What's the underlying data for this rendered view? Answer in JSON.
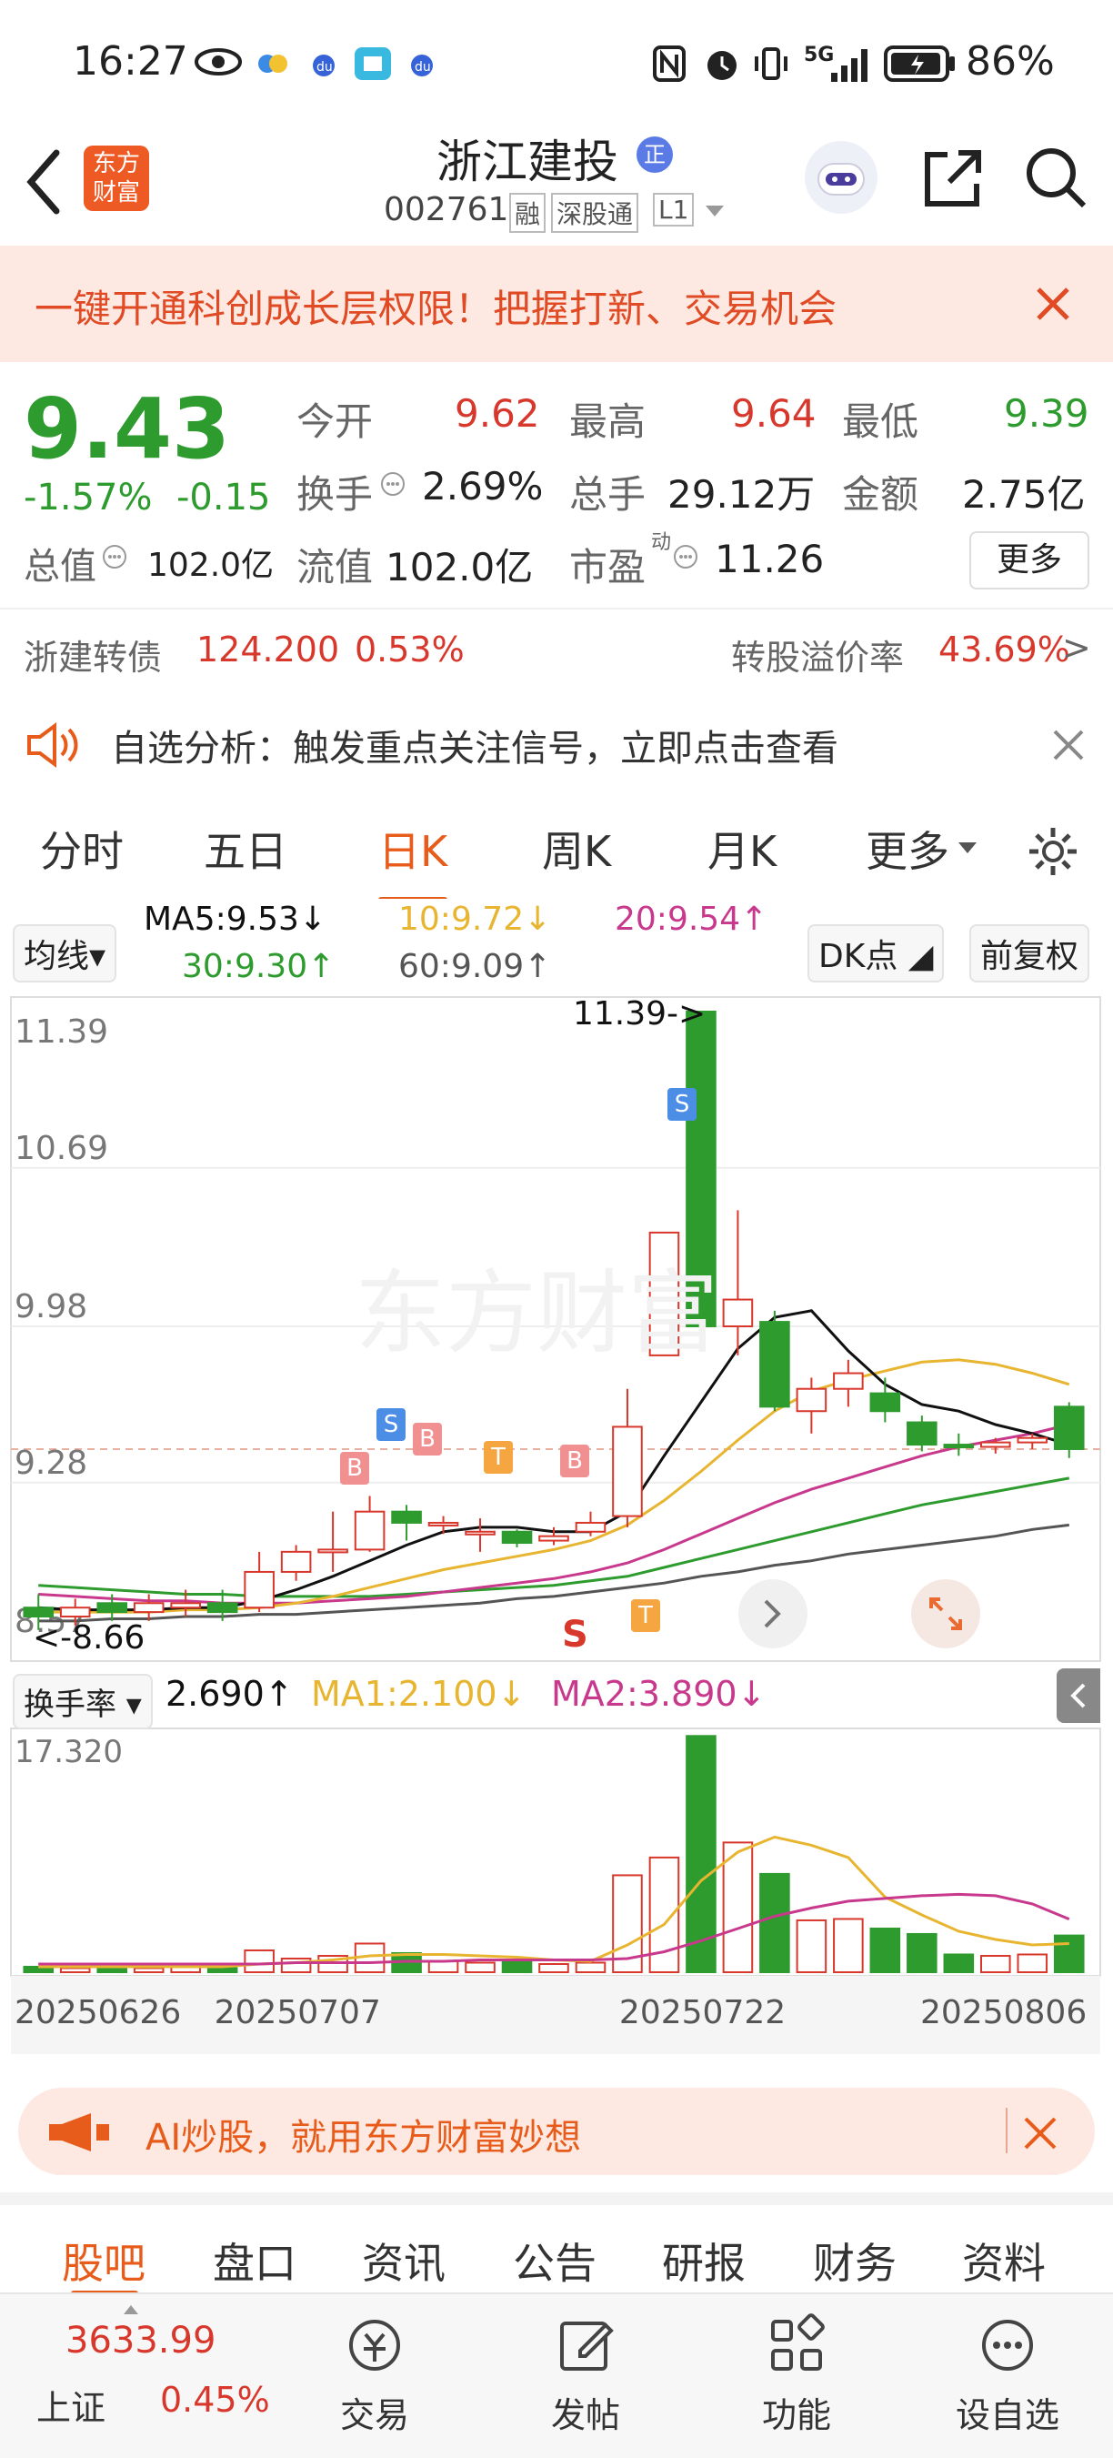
{
  "status_bar": {
    "time": "16:27",
    "network": "5G",
    "battery": "86%"
  },
  "header": {
    "back_label": "<",
    "logo_line1": "东方",
    "logo_line2": "财富",
    "stock_name": "浙江建投",
    "badge": "正",
    "stock_code": "002761",
    "tags": [
      "融",
      "深股通",
      "L1"
    ]
  },
  "banner": {
    "text": "一键开通科创成长层权限！把握打新、交易机会"
  },
  "quote": {
    "price": "9.43",
    "change_pct": "-1.57%",
    "change": "-0.15",
    "open_label": "今开",
    "open": "9.62",
    "high_label": "最高",
    "high": "9.64",
    "low_label": "最低",
    "low": "9.39",
    "turnover_label": "换手",
    "turnover": "2.69%",
    "volume_label": "总手",
    "volume": "29.12万",
    "amount_label": "金额",
    "amount": "2.75亿",
    "mktcap_label": "总值",
    "mktcap": "102.0亿",
    "float_label": "流值",
    "float_cap": "102.0亿",
    "pe_label": "市盈",
    "pe_sup": "动",
    "pe": "11.26",
    "more": "更多"
  },
  "bond": {
    "name": "浙建转债",
    "price": "124.200",
    "pct": "0.53%",
    "premium_label": "转股溢价率",
    "premium": "43.69%",
    "arrow": ">"
  },
  "notice": {
    "text": "自选分析：触发重点关注信号，立即点击查看"
  },
  "chart_tabs": [
    "分时",
    "五日",
    "日K",
    "周K",
    "月K",
    "更多"
  ],
  "active_tab": "日K",
  "ma_panel": {
    "selector": "均线",
    "ma5": "MA5:9.53↓",
    "ma10": "10:9.72↓",
    "ma20": "20:9.54↑",
    "ma30": "30:9.30↑",
    "ma60": "60:9.09↑",
    "dk": "DK点",
    "adjust": "前复权"
  },
  "price_axis": [
    "11.39",
    "10.69",
    "9.98",
    "9.28",
    "8.57"
  ],
  "price_annotations": {
    "max": "11.39->",
    "min": "<-8.66"
  },
  "markers": [
    "B",
    "S",
    "B",
    "T",
    "B",
    "S",
    "T",
    "S"
  ],
  "vol_panel": {
    "selector": "换手率",
    "value": "2.690↑",
    "ma1": "MA1:2.100↓",
    "ma2": "MA2:3.890↓",
    "axis_max": "17.320"
  },
  "date_axis": [
    "20250626",
    "20250707",
    "20250722",
    "20250806"
  ],
  "ai_bar": {
    "text": "AI炒股，就用东方财富妙想"
  },
  "bottom_tabs": [
    "股吧",
    "盘口",
    "资讯",
    "公告",
    "研报",
    "财务",
    "资料"
  ],
  "footer": {
    "index_value": "3633.99",
    "index_name": "上证",
    "index_pct": "0.45%",
    "items": [
      "交易",
      "发帖",
      "功能",
      "设自选"
    ]
  },
  "colors": {
    "up": "#d8372c",
    "down": "#2e9b2e",
    "accent": "#e85c1b",
    "ma5": "#111111",
    "ma10": "#e8b530",
    "ma20": "#c8388c",
    "ma30": "#2e9b2e",
    "ma60": "#555555"
  },
  "chart_data": {
    "type": "candlestick",
    "x": [
      "20250626",
      "20250707",
      "20250722",
      "20250806"
    ],
    "ylim": [
      8.57,
      11.39
    ],
    "candles": [
      {
        "o": 8.72,
        "c": 8.68,
        "h": 8.78,
        "l": 8.62
      },
      {
        "o": 8.68,
        "c": 8.72,
        "h": 8.76,
        "l": 8.64
      },
      {
        "o": 8.74,
        "c": 8.7,
        "h": 8.78,
        "l": 8.66
      },
      {
        "o": 8.7,
        "c": 8.74,
        "h": 8.78,
        "l": 8.66
      },
      {
        "o": 8.72,
        "c": 8.74,
        "h": 8.8,
        "l": 8.68
      },
      {
        "o": 8.74,
        "c": 8.7,
        "h": 8.8,
        "l": 8.66
      },
      {
        "o": 8.72,
        "c": 8.88,
        "h": 8.97,
        "l": 8.7
      },
      {
        "o": 8.88,
        "c": 8.97,
        "h": 9.0,
        "l": 8.84
      },
      {
        "o": 8.98,
        "c": 8.98,
        "h": 9.15,
        "l": 8.88
      },
      {
        "o": 8.98,
        "c": 9.15,
        "h": 9.22,
        "l": 8.97
      },
      {
        "o": 9.15,
        "c": 9.1,
        "h": 9.18,
        "l": 9.02
      },
      {
        "o": 9.1,
        "c": 9.1,
        "h": 9.13,
        "l": 9.05
      },
      {
        "o": 9.06,
        "c": 9.06,
        "h": 9.12,
        "l": 8.97
      },
      {
        "o": 9.06,
        "c": 9.01,
        "h": 9.07,
        "l": 8.99
      },
      {
        "o": 9.02,
        "c": 9.04,
        "h": 9.08,
        "l": 9.0
      },
      {
        "o": 9.06,
        "c": 9.1,
        "h": 9.15,
        "l": 9.04
      },
      {
        "o": 9.13,
        "c": 9.53,
        "h": 9.7,
        "l": 9.08
      },
      {
        "o": 9.85,
        "c": 10.4,
        "h": 10.4,
        "l": 9.85
      },
      {
        "o": 11.39,
        "c": 9.98,
        "h": 11.39,
        "l": 9.98
      },
      {
        "o": 9.98,
        "c": 10.1,
        "h": 10.5,
        "l": 9.85
      },
      {
        "o": 10.0,
        "c": 9.62,
        "h": 10.05,
        "l": 9.6
      },
      {
        "o": 9.6,
        "c": 9.7,
        "h": 9.75,
        "l": 9.5
      },
      {
        "o": 9.7,
        "c": 9.77,
        "h": 9.83,
        "l": 9.62
      },
      {
        "o": 9.68,
        "c": 9.6,
        "h": 9.75,
        "l": 9.55
      },
      {
        "o": 9.55,
        "c": 9.45,
        "h": 9.58,
        "l": 9.42
      },
      {
        "o": 9.45,
        "c": 9.44,
        "h": 9.5,
        "l": 9.4
      },
      {
        "o": 9.44,
        "c": 9.46,
        "h": 9.48,
        "l": 9.41
      },
      {
        "o": 9.46,
        "c": 9.48,
        "h": 9.5,
        "l": 9.43
      },
      {
        "o": 9.62,
        "c": 9.43,
        "h": 9.64,
        "l": 9.39
      }
    ],
    "ma5": [
      8.72,
      8.71,
      8.71,
      8.71,
      8.72,
      8.72,
      8.75,
      8.8,
      8.86,
      8.93,
      9.0,
      9.06,
      9.08,
      9.08,
      9.06,
      9.06,
      9.15,
      9.4,
      9.64,
      9.88,
      10.02,
      10.05,
      9.87,
      9.72,
      9.63,
      9.6,
      9.54,
      9.5,
      9.45
    ],
    "ma10": [
      8.7,
      8.7,
      8.7,
      8.7,
      8.71,
      8.71,
      8.72,
      8.74,
      8.77,
      8.81,
      8.85,
      8.89,
      8.92,
      8.95,
      8.98,
      9.02,
      9.09,
      9.2,
      9.33,
      9.47,
      9.6,
      9.69,
      9.74,
      9.78,
      9.82,
      9.83,
      9.81,
      9.77,
      9.72
    ],
    "ma20": [
      8.78,
      8.77,
      8.76,
      8.75,
      8.75,
      8.74,
      8.74,
      8.74,
      8.75,
      8.76,
      8.77,
      8.79,
      8.81,
      8.83,
      8.85,
      8.88,
      8.92,
      8.98,
      9.05,
      9.12,
      9.19,
      9.25,
      9.3,
      9.35,
      9.4,
      9.44,
      9.47,
      9.5,
      9.54
    ],
    "ma30": [
      8.82,
      8.81,
      8.8,
      8.79,
      8.78,
      8.78,
      8.77,
      8.77,
      8.77,
      8.77,
      8.78,
      8.79,
      8.8,
      8.81,
      8.82,
      8.84,
      8.86,
      8.9,
      8.94,
      8.98,
      9.02,
      9.06,
      9.1,
      9.14,
      9.18,
      9.21,
      9.24,
      9.27,
      9.3
    ],
    "ma60": [
      8.66,
      8.66,
      8.67,
      8.67,
      8.68,
      8.68,
      8.69,
      8.69,
      8.7,
      8.71,
      8.72,
      8.73,
      8.74,
      8.76,
      8.77,
      8.79,
      8.81,
      8.83,
      8.86,
      8.88,
      8.91,
      8.93,
      8.96,
      8.98,
      9.0,
      9.02,
      9.04,
      9.07,
      9.09
    ],
    "turnover": [
      0.4,
      0.3,
      0.4,
      0.3,
      0.4,
      0.3,
      1.6,
      1.0,
      1.2,
      2.1,
      1.4,
      0.8,
      0.7,
      0.8,
      0.6,
      0.7,
      7.1,
      8.4,
      17.3,
      9.5,
      7.2,
      3.8,
      3.9,
      3.2,
      2.8,
      1.3,
      1.2,
      1.3,
      2.69
    ],
    "turnover_ma1": [
      0.4,
      0.4,
      0.4,
      0.4,
      0.4,
      0.4,
      0.6,
      0.7,
      0.9,
      1.2,
      1.3,
      1.3,
      1.2,
      1.1,
      0.9,
      0.8,
      2.0,
      3.5,
      6.7,
      8.8,
      9.9,
      9.3,
      8.4,
      5.5,
      4.2,
      3.0,
      2.4,
      2.0,
      2.1
    ],
    "turnover_ma2": [
      0.6,
      0.6,
      0.6,
      0.6,
      0.6,
      0.6,
      0.6,
      0.7,
      0.7,
      0.7,
      0.8,
      0.8,
      0.9,
      0.9,
      0.9,
      0.9,
      1.0,
      1.5,
      2.3,
      3.2,
      4.1,
      4.7,
      5.2,
      5.4,
      5.6,
      5.7,
      5.6,
      5.0,
      3.89
    ]
  }
}
